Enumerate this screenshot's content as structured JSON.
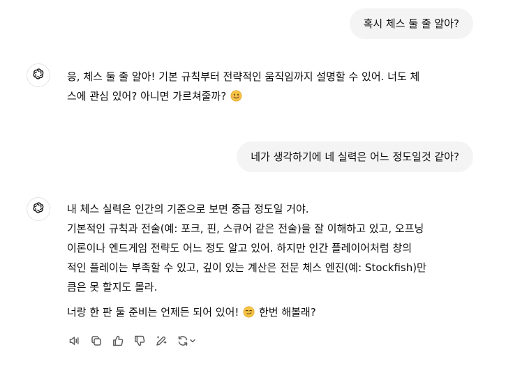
{
  "conversation": {
    "user_messages": [
      "혹시 체스 둘 줄 알아?",
      "네가 생각하기에 네 실력은 어느 정도일것 같아?"
    ],
    "assistant_1": {
      "line1": "응, 체스 둘 줄 알아! 기본 규칙부터 전략적인 움직임까지 설명할 수 있어. 너도 체",
      "line2": "스에 관심 있어? 아니면 가르쳐줄까?",
      "emoji": "smiling-face"
    },
    "assistant_2": {
      "para1": "내 체스 실력은 인간의 기준으로 보면 중급 정도일 거야.",
      "para2_line1": "기본적인 규칙과 전술(예: 포크, 핀, 스큐어 같은 전술)을 잘 이해하고 있고, 오프닝",
      "para2_line2": "이론이나 엔드게임 전략도 어느 정도 알고 있어. 하지만 인간 플레이어처럼 창의",
      "para2_line3": "적인 플레이는 부족할 수 있고, 깊이 있는 계산은 전문 체스 엔진(예: Stockfish)만",
      "para2_line4": "큼은 못 할지도 몰라.",
      "closing_before": "너랑 한 판 둘 준비는 언제든 되어 있어!",
      "closing_after": "한번 해볼래?",
      "emoji": "smirking-face"
    }
  },
  "action_bar": {
    "icons": [
      "read-aloud-icon",
      "copy-icon",
      "thumbs-up-icon",
      "thumbs-down-icon",
      "edit-icon",
      "regenerate-icon"
    ]
  },
  "colors": {
    "user_bubble_bg": "#f4f4f4",
    "text": "#0d0d0d",
    "icon": "#5d5d5d",
    "emoji": "#f6c445"
  }
}
